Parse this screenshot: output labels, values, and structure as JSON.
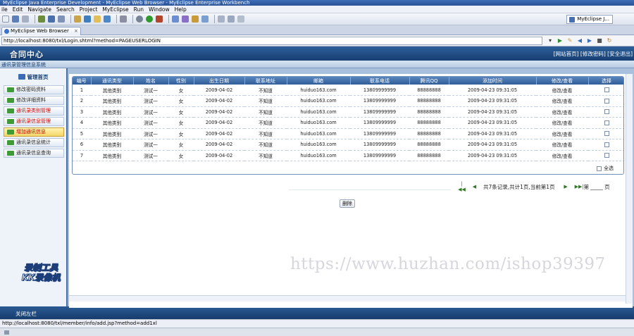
{
  "window": {
    "title": "MyEclipse Java Enterprise Development - MyEclipse Web Browser - MyEclipse Enterprise Workbench"
  },
  "menu": [
    "ile",
    "Edit",
    "Navigate",
    "Search",
    "Project",
    "MyEclipse",
    "Run",
    "Window",
    "Help"
  ],
  "perspective": {
    "label": "MyEclipse J..."
  },
  "tab": {
    "label": "MyEclipse Web Browser"
  },
  "browser": {
    "url": "http://localhost:8080/txl/Login.shtml?method=PAGEUSERLOGIN",
    "status_url": "http://localhost:8080/txl/member/info/add.jsp?method=add1xl"
  },
  "app": {
    "logo": "合同中心",
    "user_info": "[网站首页] [修改密码] [安全退出]",
    "subtitle": "通讯录管理信息系统",
    "sidebar_title": "管理首页",
    "sidebar_items": [
      "修改密码资料",
      "修改详细资料",
      "通讯录类别管理",
      "通讯录信息管理",
      "增加通讯信息",
      "通讯录信息统计",
      "通讯录信息查询"
    ],
    "footer": "关闭左栏",
    "logo_watermark": [
      "录制工具",
      "KK录像机"
    ]
  },
  "table": {
    "headers": [
      "编号",
      "通讯类型",
      "姓名",
      "性别",
      "出生日期",
      "联系地址",
      "邮箱",
      "联系电话",
      "腾讯QQ",
      "添加时间",
      "修改/查看",
      "选择"
    ],
    "rows": [
      [
        "1",
        "其他类别",
        "测试一",
        "女",
        "2009-04-02",
        "不知道",
        "huiduo163.com",
        "13809999999",
        "88888888",
        "2009-04-23 09:31:05",
        "修改/查看"
      ],
      [
        "2",
        "其他类别",
        "测试一",
        "女",
        "2009-04-02",
        "不知道",
        "huiduo163.com",
        "13809999999",
        "88888888",
        "2009-04-23 09:31:05",
        "修改/查看"
      ],
      [
        "3",
        "其他类别",
        "测试一",
        "女",
        "2009-04-02",
        "不知道",
        "huiduo163.com",
        "13809999999",
        "88888888",
        "2009-04-23 09:31:05",
        "修改/查看"
      ],
      [
        "4",
        "其他类别",
        "测试一",
        "女",
        "2009-04-02",
        "不知道",
        "huiduo163.com",
        "13809999999",
        "88888888",
        "2009-04-23 09:31:05",
        "修改/查看"
      ],
      [
        "5",
        "其他类别",
        "测试一",
        "女",
        "2009-04-02",
        "不知道",
        "huiduo163.com",
        "13809999999",
        "88888888",
        "2009-04-23 09:31:05",
        "修改/查看"
      ],
      [
        "6",
        "其他类别",
        "测试一",
        "女",
        "2009-04-02",
        "不知道",
        "huiduo163.com",
        "13809999999",
        "88888888",
        "2009-04-23 09:31:05",
        "修改/查看"
      ],
      [
        "7",
        "其他类别",
        "测试一",
        "女",
        "2009-04-02",
        "不知道",
        "huiduo163.com",
        "13809999999",
        "88888888",
        "2009-04-23 09:31:05",
        "修改/查看"
      ]
    ],
    "select_all": "全选"
  },
  "pager": {
    "info": "共7条记录,共计1页,当前第1页",
    "goto_prefix": "第",
    "goto_suffix": "页"
  },
  "delete_button": "删除",
  "watermark": "https://www.huzhan.com/ishop39397"
}
